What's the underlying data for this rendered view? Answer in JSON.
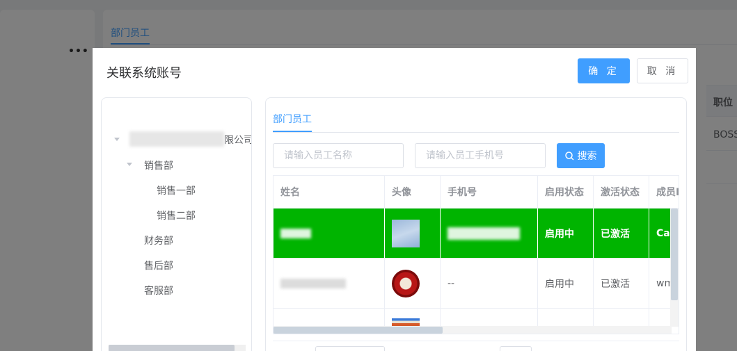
{
  "background": {
    "more_label": "•••",
    "tab_label": "部门员工",
    "table_header": "职位",
    "table_cell": "BOSS"
  },
  "dialog": {
    "title": "关联系统账号",
    "confirm_label": "确 定",
    "cancel_label": "取 消"
  },
  "tree": {
    "root_label_tail": "限公司",
    "nodes": [
      {
        "label": "销售部",
        "level": 1
      },
      {
        "label": "销售一部",
        "level": 2
      },
      {
        "label": "销售二部",
        "level": 2
      },
      {
        "label": "财务部",
        "level": 1
      },
      {
        "label": "售后部",
        "level": 1
      },
      {
        "label": "客服部",
        "level": 1
      }
    ]
  },
  "panel": {
    "tab_label": "部门员工",
    "name_placeholder": "请输入员工名称",
    "phone_placeholder": "请输入员工手机号",
    "search_label": "搜索"
  },
  "table": {
    "headers": [
      "姓名",
      "头像",
      "手机号",
      "启用状态",
      "激活状态",
      "成员I"
    ],
    "rows": [
      {
        "name": "",
        "phone": "",
        "enable": "启用中",
        "active": "已激活",
        "member": "Cac",
        "selected": true
      },
      {
        "name": "",
        "phone": "--",
        "enable": "启用中",
        "active": "已激活",
        "member": "wm",
        "selected": false
      }
    ]
  },
  "colors": {
    "primary": "#409eff",
    "selected_row": "#00b400"
  }
}
